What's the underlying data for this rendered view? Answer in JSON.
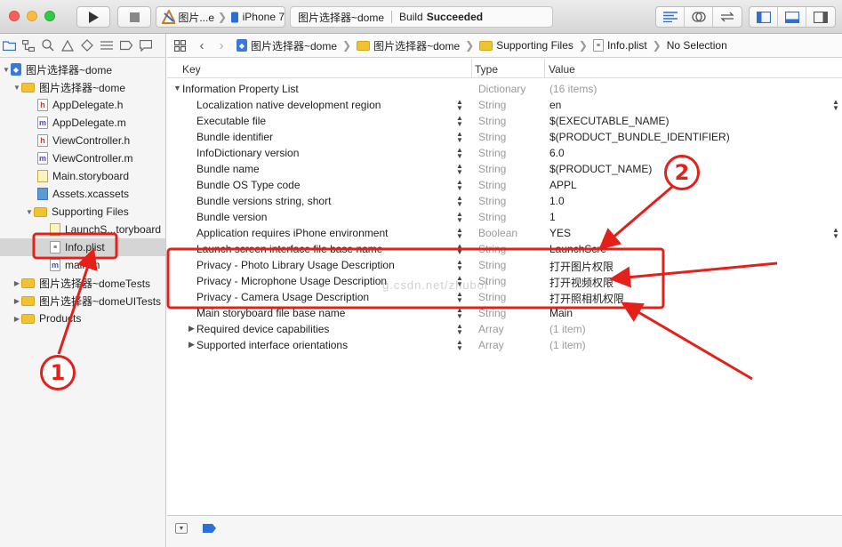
{
  "toolbar": {
    "scheme_target": "图片...e",
    "scheme_device": "iPhone 7",
    "status_project": "图片选择器~dome",
    "status_prefix": "Build",
    "status_result": "Succeeded"
  },
  "navigator": {
    "items": [
      {
        "label": "图片选择器~dome",
        "icon": "project-icon"
      },
      {
        "label": "图片选择器~dome",
        "icon": "folder-icon"
      },
      {
        "label": "AppDelegate.h",
        "icon": "header-file-icon",
        "glyph": "h"
      },
      {
        "label": "AppDelegate.m",
        "icon": "source-file-icon",
        "glyph": "m"
      },
      {
        "label": "ViewController.h",
        "icon": "header-file-icon",
        "glyph": "h"
      },
      {
        "label": "ViewController.m",
        "icon": "source-file-icon",
        "glyph": "m"
      },
      {
        "label": "Main.storyboard",
        "icon": "storyboard-icon"
      },
      {
        "label": "Assets.xcassets",
        "icon": "assets-icon"
      },
      {
        "label": "Supporting Files",
        "icon": "folder-icon"
      },
      {
        "label": "LaunchS...toryboard",
        "icon": "storyboard-icon"
      },
      {
        "label": "Info.plist",
        "icon": "plist-file-icon"
      },
      {
        "label": "main.m",
        "icon": "source-file-icon",
        "glyph": "m"
      },
      {
        "label": "图片选择器~domeTests",
        "icon": "folder-icon"
      },
      {
        "label": "图片选择器~domeUITests",
        "icon": "folder-icon"
      },
      {
        "label": "Products",
        "icon": "folder-icon"
      }
    ]
  },
  "jumpbar": {
    "crumbs": [
      "图片选择器~dome",
      "图片选择器~dome",
      "Supporting Files",
      "Info.plist",
      "No Selection"
    ]
  },
  "plist": {
    "columns": {
      "key": "Key",
      "type": "Type",
      "value": "Value"
    },
    "rows": [
      {
        "key": "Information Property List",
        "type": "Dictionary",
        "value": "(16 items)"
      },
      {
        "key": "Localization native development region",
        "type": "String",
        "value": "en"
      },
      {
        "key": "Executable file",
        "type": "String",
        "value": "$(EXECUTABLE_NAME)"
      },
      {
        "key": "Bundle identifier",
        "type": "String",
        "value": "$(PRODUCT_BUNDLE_IDENTIFIER)"
      },
      {
        "key": "InfoDictionary version",
        "type": "String",
        "value": "6.0"
      },
      {
        "key": "Bundle name",
        "type": "String",
        "value": "$(PRODUCT_NAME)"
      },
      {
        "key": "Bundle OS Type code",
        "type": "String",
        "value": "APPL"
      },
      {
        "key": "Bundle versions string, short",
        "type": "String",
        "value": "1.0"
      },
      {
        "key": "Bundle version",
        "type": "String",
        "value": "1"
      },
      {
        "key": "Application requires iPhone environment",
        "type": "Boolean",
        "value": "YES"
      },
      {
        "key": "Launch screen interface file base name",
        "type": "String",
        "value": "LaunchScre"
      },
      {
        "key": "Privacy - Photo Library Usage Description",
        "type": "String",
        "value": "打开图片权限"
      },
      {
        "key": "Privacy - Microphone Usage Description",
        "type": "String",
        "value": "打开视频权限"
      },
      {
        "key": "Privacy - Camera Usage Description",
        "type": "String",
        "value": "打开照相机权限"
      },
      {
        "key": "Main storyboard file base name",
        "type": "String",
        "value": "Main"
      },
      {
        "key": "Required device capabilities",
        "type": "Array",
        "value": "(1 item)"
      },
      {
        "key": "Supported interface orientations",
        "type": "Array",
        "value": "(1 item)"
      }
    ]
  },
  "annotations": {
    "badge1": "1",
    "badge2": "2",
    "watermark": "g.csdn.net/zhubol",
    "color": "#e4201b"
  }
}
